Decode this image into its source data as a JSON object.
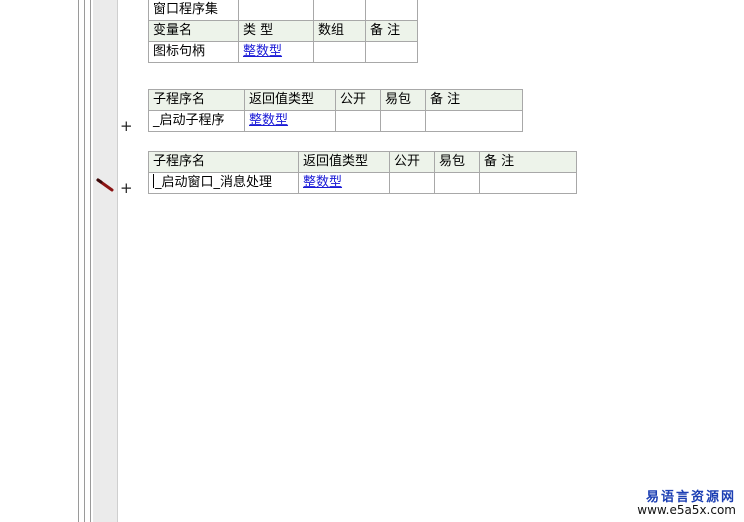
{
  "table1": {
    "row_top": "窗口程序集",
    "header": [
      "变量名",
      "类 型",
      "数组",
      "备 注"
    ],
    "row": {
      "name": "图标句柄",
      "type": "整数型"
    }
  },
  "table2": {
    "header": [
      "子程序名",
      "返回值类型",
      "公开",
      "易包",
      "备 注"
    ],
    "row": {
      "name": "_启动子程序",
      "type": "整数型"
    }
  },
  "table3": {
    "header": [
      "子程序名",
      "返回值类型",
      "公开",
      "易包",
      "备 注"
    ],
    "row": {
      "name": "_启动窗口_消息处理",
      "type": "整数型"
    }
  },
  "gutter": {
    "plus": "+"
  },
  "watermark": {
    "title": "易语言资源网",
    "url": "www.e5a5x.com"
  },
  "icons": {
    "edit": "pen-icon"
  }
}
